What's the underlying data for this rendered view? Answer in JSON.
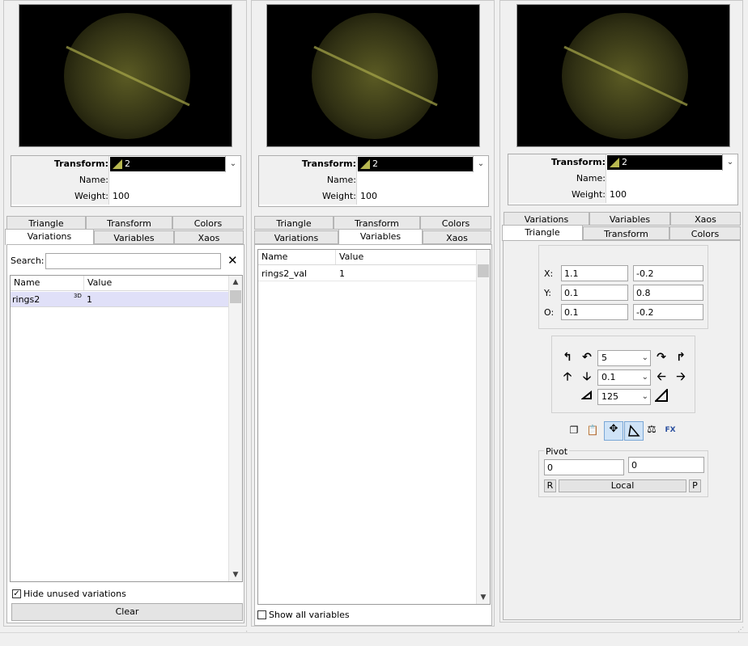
{
  "transform_label": "Transform:",
  "transform_value": "2",
  "name_label": "Name:",
  "name_value": "",
  "weight_label": "Weight:",
  "weight_value": "100",
  "tabs": {
    "triangle": "Triangle",
    "transform": "Transform",
    "colors": "Colors",
    "variations": "Variations",
    "variables": "Variables",
    "xaos": "Xaos"
  },
  "panel1": {
    "search_label": "Search:",
    "search_value": "",
    "col_name": "Name",
    "col_value": "Value",
    "rows": [
      {
        "name": "rings2",
        "badge": "3D",
        "value": "1"
      }
    ],
    "hide_unused_label": "Hide unused variations",
    "hide_unused_checked": true,
    "clear_label": "Clear"
  },
  "panel2": {
    "col_name": "Name",
    "col_value": "Value",
    "rows": [
      {
        "name": "rings2_val",
        "value": "1"
      }
    ],
    "show_all_label": "Show all variables",
    "show_all_checked": false
  },
  "panel3": {
    "x_label": "X:",
    "x1": "1.1",
    "x2": "-0.2",
    "y_label": "Y:",
    "y1": "0.1",
    "y2": "0.8",
    "o_label": "O:",
    "o1": "0.1",
    "o2": "-0.2",
    "rotate_value": "5",
    "move_value": "0.1",
    "scale_value": "125",
    "pivot_label": "Pivot",
    "pivot_x": "0",
    "pivot_y": "0",
    "reset_btn": "R",
    "local_btn": "Local",
    "pick_btn": "P"
  },
  "icons": {
    "copy": "copy-icon",
    "paste": "paste-icon",
    "select": "select-mode-icon",
    "triangle": "triangle-mode-icon",
    "balance": "balance-icon",
    "fx": "fx-icon"
  },
  "colors": {
    "preview_bg": "#000000",
    "flame": "#8a8a3a",
    "selection": "#e0e0f8"
  }
}
